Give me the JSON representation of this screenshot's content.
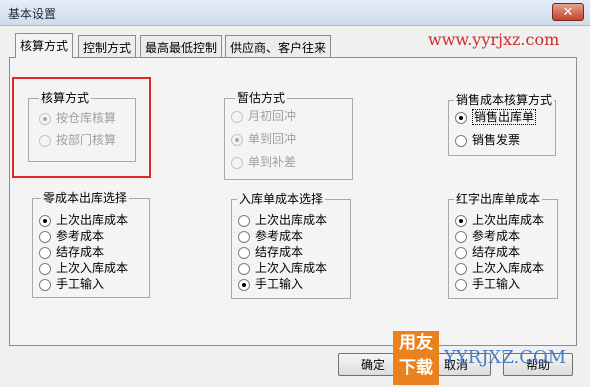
{
  "window": {
    "title": "基本设置",
    "close_glyph": "✕"
  },
  "tabs": [
    {
      "label": "核算方式",
      "active": true
    },
    {
      "label": "控制方式",
      "active": false
    },
    {
      "label": "最高最低控制",
      "active": false
    },
    {
      "label": "供应商、客户往来",
      "active": false
    }
  ],
  "watermark": "www.yyrjxz.com",
  "groups": {
    "accounting_method": {
      "title": "核算方式",
      "options": [
        "按仓库核算",
        "按部门核算"
      ],
      "selected": 0,
      "disabled": true
    },
    "provisional_method": {
      "title": "暂估方式",
      "options": [
        "月初回冲",
        "单到回冲",
        "单到补差"
      ],
      "selected": 1,
      "disabled": true
    },
    "sales_cost_method": {
      "title": "销售成本核算方式",
      "options": [
        "销售出库单",
        "销售发票"
      ],
      "selected": 0,
      "disabled": false
    },
    "zero_cost_outbound": {
      "title": "零成本出库选择",
      "options": [
        "上次出库成本",
        "参考成本",
        "结存成本",
        "上次入库成本",
        "手工输入"
      ],
      "selected": 0,
      "disabled": false
    },
    "inbound_unit_cost": {
      "title": "入库单成本选择",
      "options": [
        "上次出库成本",
        "参考成本",
        "结存成本",
        "上次入库成本",
        "手工输入"
      ],
      "selected": 4,
      "disabled": false
    },
    "red_outbound_cost": {
      "title": "红字出库单成本",
      "options": [
        "上次出库成本",
        "参考成本",
        "结存成本",
        "上次入库成本",
        "手工输入"
      ],
      "selected": 0,
      "disabled": false
    }
  },
  "buttons": {
    "ok": "确定",
    "cancel": "取消",
    "help": "帮助"
  },
  "brand_overlay": {
    "badge_line1": "用友",
    "badge_line2": "下载",
    "text": "YYRJXZ.COM"
  },
  "colors": {
    "accent_red": "#e02828",
    "brand_orange": "#e8811e",
    "brand_blue": "#4a7fc1"
  }
}
